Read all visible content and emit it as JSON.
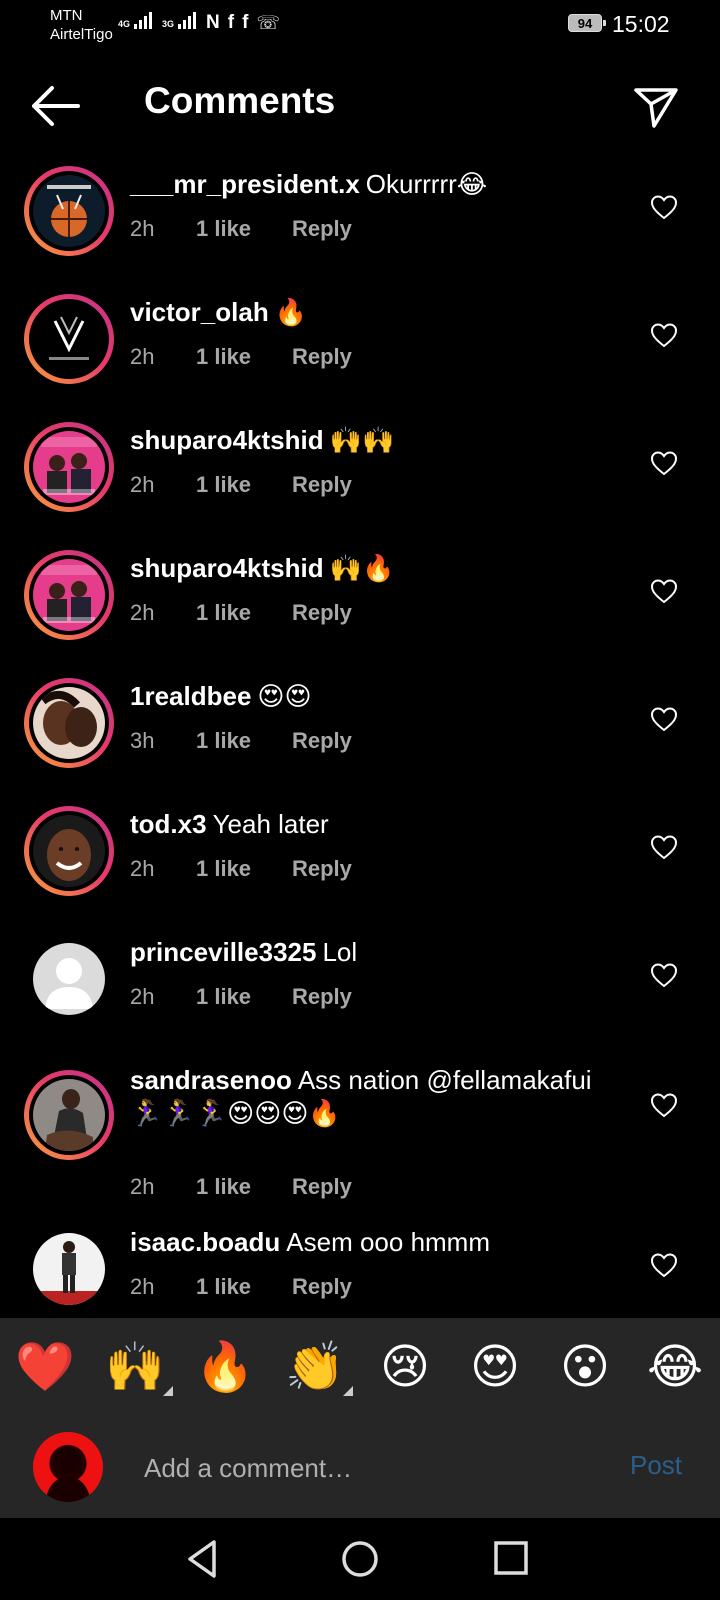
{
  "status_bar": {
    "carrier1": "MTN",
    "carrier2": "AirtelTigo",
    "net1": "4G",
    "net2": "3G",
    "notif_icons": [
      "N",
      "f",
      "f",
      "☏"
    ],
    "battery": "94",
    "time": "15:02"
  },
  "header": {
    "title": "Comments"
  },
  "comments": [
    {
      "user": "___mr_president.x",
      "text": "Okurrrrr😂",
      "time": "2h",
      "likes": "1 like",
      "reply": "Reply",
      "avatar": "basketball",
      "ring": true
    },
    {
      "user": "victor_olah",
      "text": "🔥",
      "time": "2h",
      "likes": "1 like",
      "reply": "Reply",
      "avatar": "logo",
      "ring": true
    },
    {
      "user": "shuparo4ktshid",
      "text": "🙌🙌",
      "time": "2h",
      "likes": "1 like",
      "reply": "Reply",
      "avatar": "poster",
      "ring": true
    },
    {
      "user": "shuparo4ktshid",
      "text": "🙌🔥",
      "time": "2h",
      "likes": "1 like",
      "reply": "Reply",
      "avatar": "poster",
      "ring": true
    },
    {
      "user": "1realdbee",
      "text": "😍😍",
      "time": "3h",
      "likes": "1 like",
      "reply": "Reply",
      "avatar": "couple",
      "ring": true
    },
    {
      "user": "tod.x3",
      "text": "Yeah later",
      "time": "2h",
      "likes": "1 like",
      "reply": "Reply",
      "avatar": "smile",
      "ring": true
    },
    {
      "user": "princeville3325",
      "text": "Lol",
      "time": "2h",
      "likes": "1 like",
      "reply": "Reply",
      "avatar": "default",
      "ring": false
    },
    {
      "user": "sandrasenoo",
      "text": "Ass nation @fellamakafui 🏃‍♀️🏃‍♀️🏃‍♀️😍😍😍🔥",
      "time": "2h",
      "likes": "1 like",
      "reply": "Reply",
      "avatar": "woman",
      "ring": true
    },
    {
      "user": "isaac.boadu",
      "text": "Asem ooo hmmm",
      "time": "2h",
      "likes": "1 like",
      "reply": "Reply",
      "avatar": "standing",
      "ring": false
    }
  ],
  "emoji_bar": [
    "❤️",
    "🙌",
    "🔥",
    "👏",
    "😢",
    "😍",
    "😮",
    "😂"
  ],
  "comment_input": {
    "placeholder": "Add a comment…",
    "post_label": "Post"
  },
  "colors": {
    "background": "#000000",
    "bar": "#262626",
    "post": "#2a5f8c",
    "meta": "#a8a8a8"
  }
}
